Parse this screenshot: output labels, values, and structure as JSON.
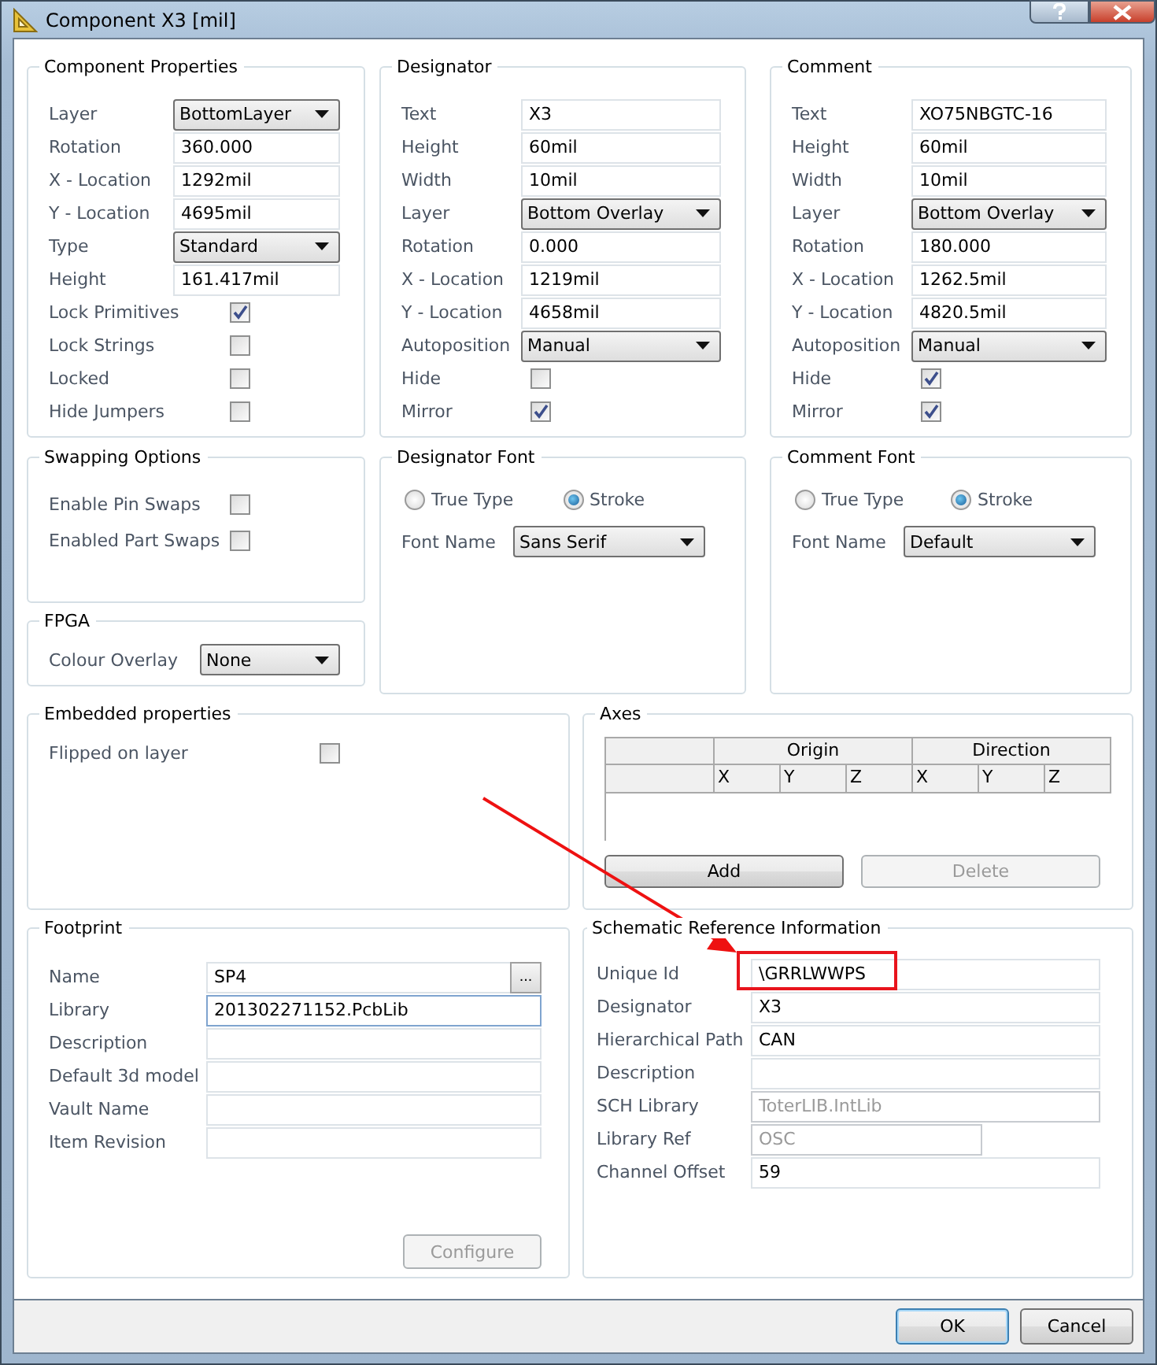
{
  "window": {
    "title": "Component X3 [mil]"
  },
  "component_properties": {
    "title": "Component Properties",
    "fields": [
      {
        "kind": "select",
        "label": "Layer",
        "value": "BottomLayer"
      },
      {
        "kind": "text",
        "label": "Rotation",
        "value": "360.000"
      },
      {
        "kind": "text",
        "label": "X - Location",
        "value": "1292mil"
      },
      {
        "kind": "text",
        "label": "Y - Location",
        "value": "4695mil"
      },
      {
        "kind": "select",
        "label": "Type",
        "value": "Standard"
      },
      {
        "kind": "text",
        "label": "Height",
        "value": "161.417mil"
      },
      {
        "kind": "checkbox",
        "label": "Lock Primitives",
        "checked": true
      },
      {
        "kind": "checkbox",
        "label": "Lock Strings",
        "checked": false
      },
      {
        "kind": "checkbox",
        "label": "Locked",
        "checked": false
      },
      {
        "kind": "checkbox",
        "label": "Hide Jumpers",
        "checked": false
      }
    ]
  },
  "designator": {
    "title": "Designator",
    "fields": [
      {
        "kind": "text",
        "label": "Text",
        "value": "X3"
      },
      {
        "kind": "text",
        "label": "Height",
        "value": "60mil"
      },
      {
        "kind": "text",
        "label": "Width",
        "value": "10mil"
      },
      {
        "kind": "select",
        "label": "Layer",
        "value": "Bottom Overlay"
      },
      {
        "kind": "text",
        "label": "Rotation",
        "value": "0.000"
      },
      {
        "kind": "text",
        "label": "X - Location",
        "value": "1219mil"
      },
      {
        "kind": "text",
        "label": "Y - Location",
        "value": "4658mil"
      },
      {
        "kind": "select",
        "label": "Autoposition",
        "value": "Manual"
      },
      {
        "kind": "checkbox",
        "label": "Hide",
        "checked": false
      },
      {
        "kind": "checkbox",
        "label": "Mirror",
        "checked": true
      }
    ]
  },
  "comment": {
    "title": "Comment",
    "fields": [
      {
        "kind": "text",
        "label": "Text",
        "value": "XO75NBGTC-16"
      },
      {
        "kind": "text",
        "label": "Height",
        "value": "60mil"
      },
      {
        "kind": "text",
        "label": "Width",
        "value": "10mil"
      },
      {
        "kind": "select",
        "label": "Layer",
        "value": "Bottom Overlay"
      },
      {
        "kind": "text",
        "label": "Rotation",
        "value": "180.000"
      },
      {
        "kind": "text",
        "label": "X - Location",
        "value": "1262.5mil"
      },
      {
        "kind": "text",
        "label": "Y - Location",
        "value": "4820.5mil"
      },
      {
        "kind": "select",
        "label": "Autoposition",
        "value": "Manual"
      },
      {
        "kind": "checkbox",
        "label": "Hide",
        "checked": true
      },
      {
        "kind": "checkbox",
        "label": "Mirror",
        "checked": true
      }
    ]
  },
  "swapping_options": {
    "title": "Swapping Options",
    "fields": [
      {
        "kind": "checkbox",
        "label": "Enable Pin Swaps",
        "checked": false
      },
      {
        "kind": "checkbox",
        "label": "Enabled Part Swaps",
        "checked": false
      }
    ]
  },
  "fpga": {
    "title": "FPGA",
    "fields": [
      {
        "kind": "select",
        "label": "Colour Overlay",
        "value": "None"
      }
    ]
  },
  "designator_font": {
    "title": "Designator Font",
    "radios": [
      {
        "label": "True Type",
        "selected": false
      },
      {
        "label": "Stroke",
        "selected": true
      }
    ],
    "fields": [
      {
        "kind": "select",
        "label": "Font Name",
        "value": "Sans Serif"
      }
    ]
  },
  "comment_font": {
    "title": "Comment Font",
    "radios": [
      {
        "label": "True Type",
        "selected": false
      },
      {
        "label": "Stroke",
        "selected": true
      }
    ],
    "fields": [
      {
        "kind": "select",
        "label": "Font Name",
        "value": "Default"
      }
    ]
  },
  "embedded_properties": {
    "title": "Embedded properties",
    "fields": [
      {
        "kind": "checkbox",
        "label": "Flipped on layer",
        "checked": false
      }
    ]
  },
  "axes": {
    "title": "Axes",
    "header_groups": [
      "Origin",
      "Direction"
    ],
    "columns": [
      "X",
      "Y",
      "Z",
      "X",
      "Y",
      "Z"
    ],
    "buttons": [
      {
        "label": "Add",
        "disabled": false
      },
      {
        "label": "Delete",
        "disabled": true
      }
    ]
  },
  "footprint": {
    "title": "Footprint",
    "fields": [
      {
        "kind": "browse",
        "label": "Name",
        "value": "SP4",
        "button": "..."
      },
      {
        "kind": "text",
        "label": "Library",
        "value": "201302271152.PcbLib",
        "focused": true
      },
      {
        "kind": "text",
        "label": "Description"
      },
      {
        "kind": "text",
        "label": "Default 3d model"
      },
      {
        "kind": "text",
        "label": "Vault Name"
      },
      {
        "kind": "text",
        "label": "Item Revision"
      }
    ],
    "buttons": [
      {
        "label": "Configure",
        "disabled": true
      }
    ]
  },
  "schematic_reference": {
    "title": "Schematic Reference Information",
    "fields": [
      {
        "kind": "text",
        "label": "Unique Id",
        "value": "\\GRRLWWPS",
        "highlighted": true
      },
      {
        "kind": "text",
        "label": "Designator",
        "value": "X3"
      },
      {
        "kind": "text",
        "label": "Hierarchical Path",
        "value": "CAN"
      },
      {
        "kind": "text",
        "label": "Description"
      },
      {
        "kind": "text",
        "label": "SCH Library",
        "value": "ToterLIB.IntLib",
        "disabled": true
      },
      {
        "kind": "short",
        "label": "Library Ref",
        "value": "OSC",
        "disabled": true
      },
      {
        "kind": "text",
        "label": "Channel Offset",
        "value": "59"
      }
    ]
  },
  "footer": {
    "buttons": [
      {
        "label": "OK",
        "default": true
      },
      {
        "label": "Cancel",
        "default": false
      }
    ]
  },
  "annotations": [
    {
      "kind": "arrow"
    }
  ]
}
